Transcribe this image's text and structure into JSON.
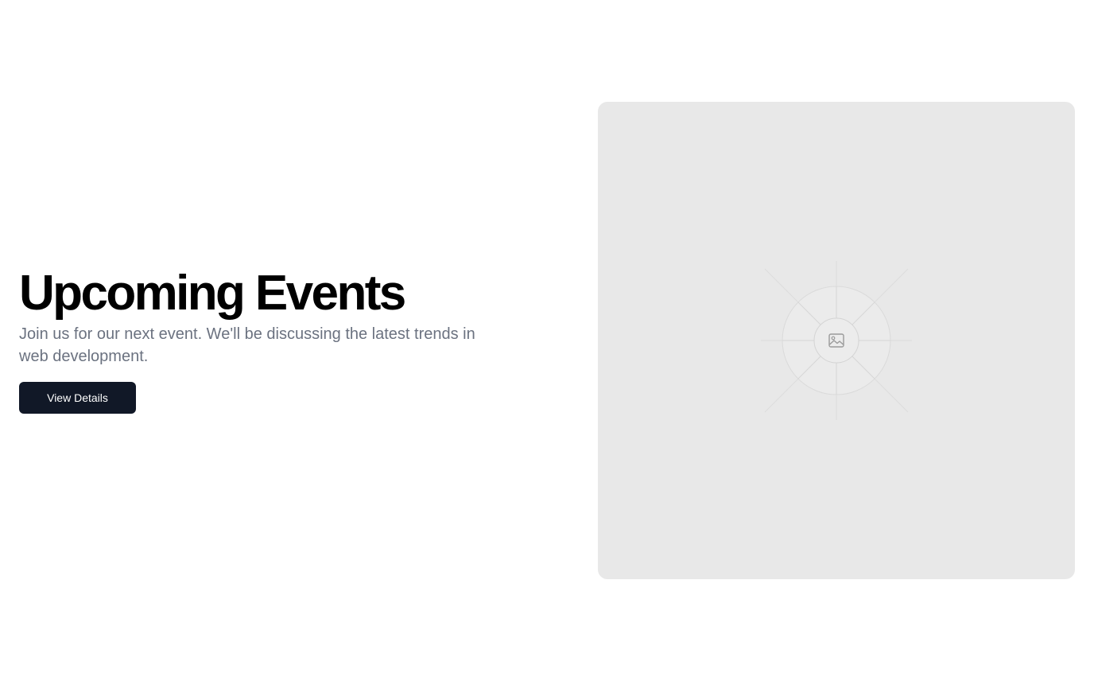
{
  "hero": {
    "title": "Upcoming Events",
    "subtitle": "Join us for our next event. We'll be discussing the latest trends in web development.",
    "cta_label": "View Details"
  },
  "media": {
    "icon": "image-icon",
    "background_color": "#e8e8e8"
  },
  "colors": {
    "button_bg": "#111827",
    "subtitle_text": "#6b7280",
    "title_text": "#000000"
  }
}
